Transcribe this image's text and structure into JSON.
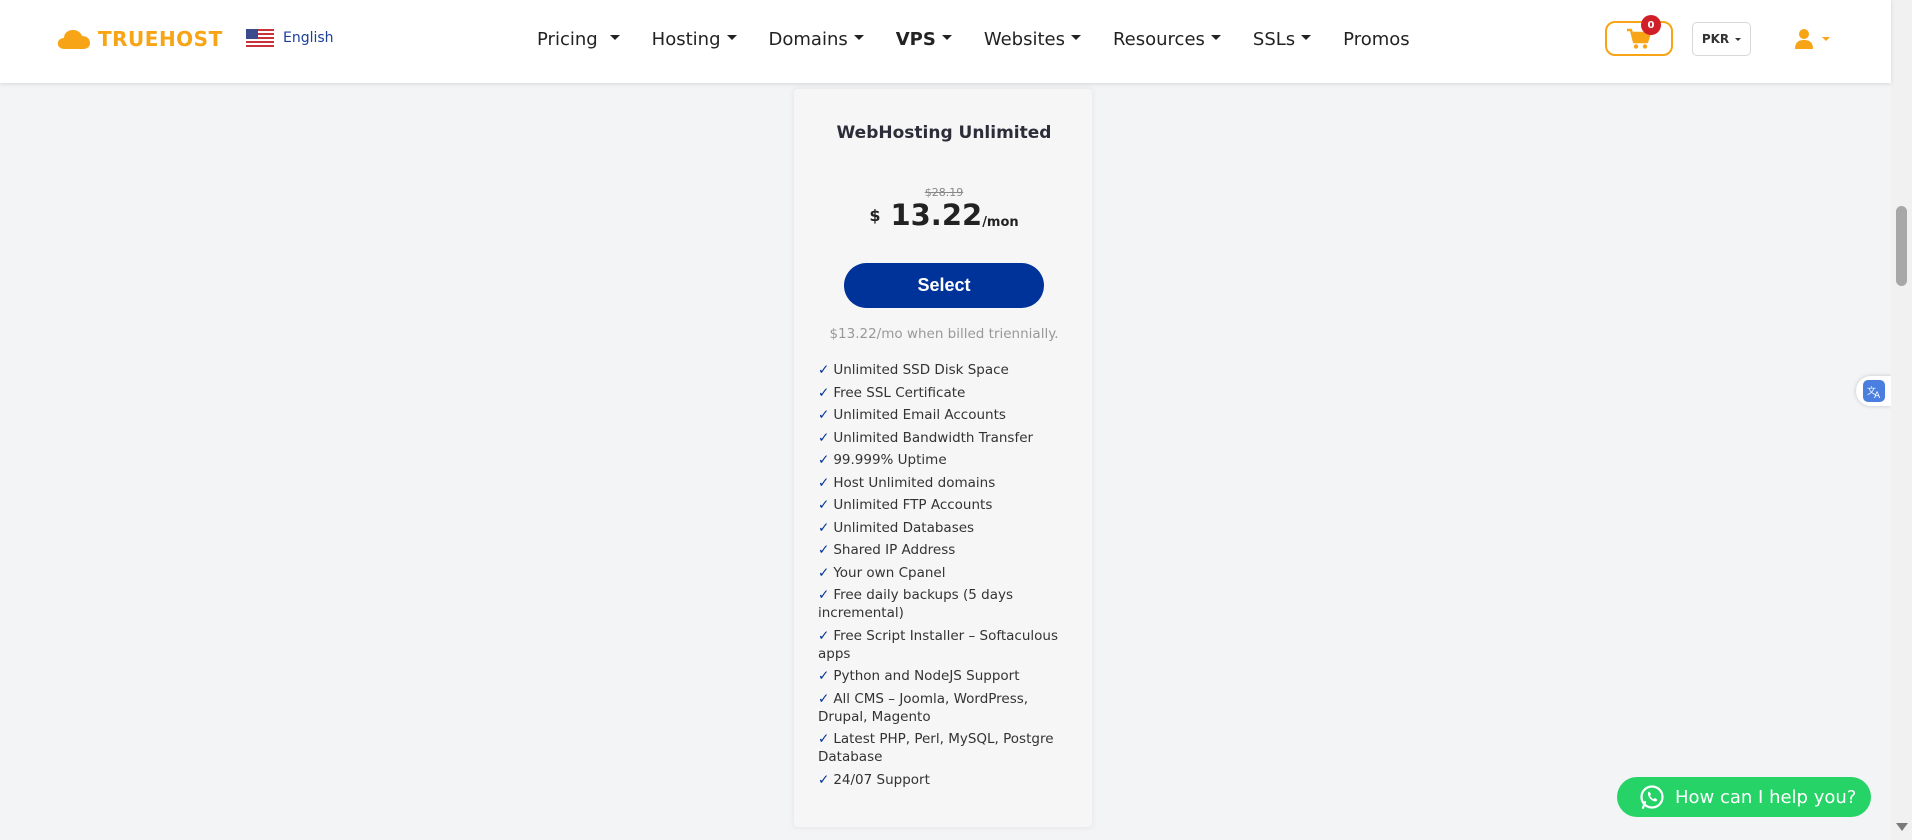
{
  "brand": {
    "name": "TRUEHOST",
    "accent": "#f7a416",
    "primary": "#003399"
  },
  "language": {
    "label": "English",
    "icon": "us-flag-icon"
  },
  "nav": [
    {
      "label": "Pricing"
    },
    {
      "label": "Hosting"
    },
    {
      "label": "Domains"
    },
    {
      "label": "VPS"
    },
    {
      "label": "Websites"
    },
    {
      "label": "Resources"
    },
    {
      "label": "SSLs"
    },
    {
      "label": "Promos"
    }
  ],
  "cart": {
    "count": "0",
    "icon": "cart-icon"
  },
  "currency": {
    "label": "PKR"
  },
  "user": {
    "icon": "user-icon"
  },
  "plan": {
    "title": "WebHosting Unlimited",
    "old_price": "$28.19",
    "currency_symbol": "$",
    "price": "13.22",
    "unit": "/mon",
    "select_label": "Select",
    "billing_note": "$13.22/mo when billed triennially.",
    "features": [
      "Unlimited SSD Disk Space",
      "Free SSL Certificate",
      "Unlimited Email Accounts",
      "Unlimited Bandwidth Transfer",
      "99.999% Uptime",
      "Host Unlimited domains",
      "Unlimited FTP Accounts",
      "Unlimited Databases",
      "Shared IP Address",
      "Your own Cpanel",
      "Free daily backups (5 days incremental)",
      "Free Script Installer – Softaculous apps",
      "Python and NodeJS Support",
      "All CMS – Joomla, WordPress, Drupal, Magento",
      "Latest PHP, Perl, MySQL, Postgre Database",
      "24/07 Support"
    ]
  },
  "help": {
    "label": "How can I help you?",
    "icon": "whatsapp-icon"
  }
}
